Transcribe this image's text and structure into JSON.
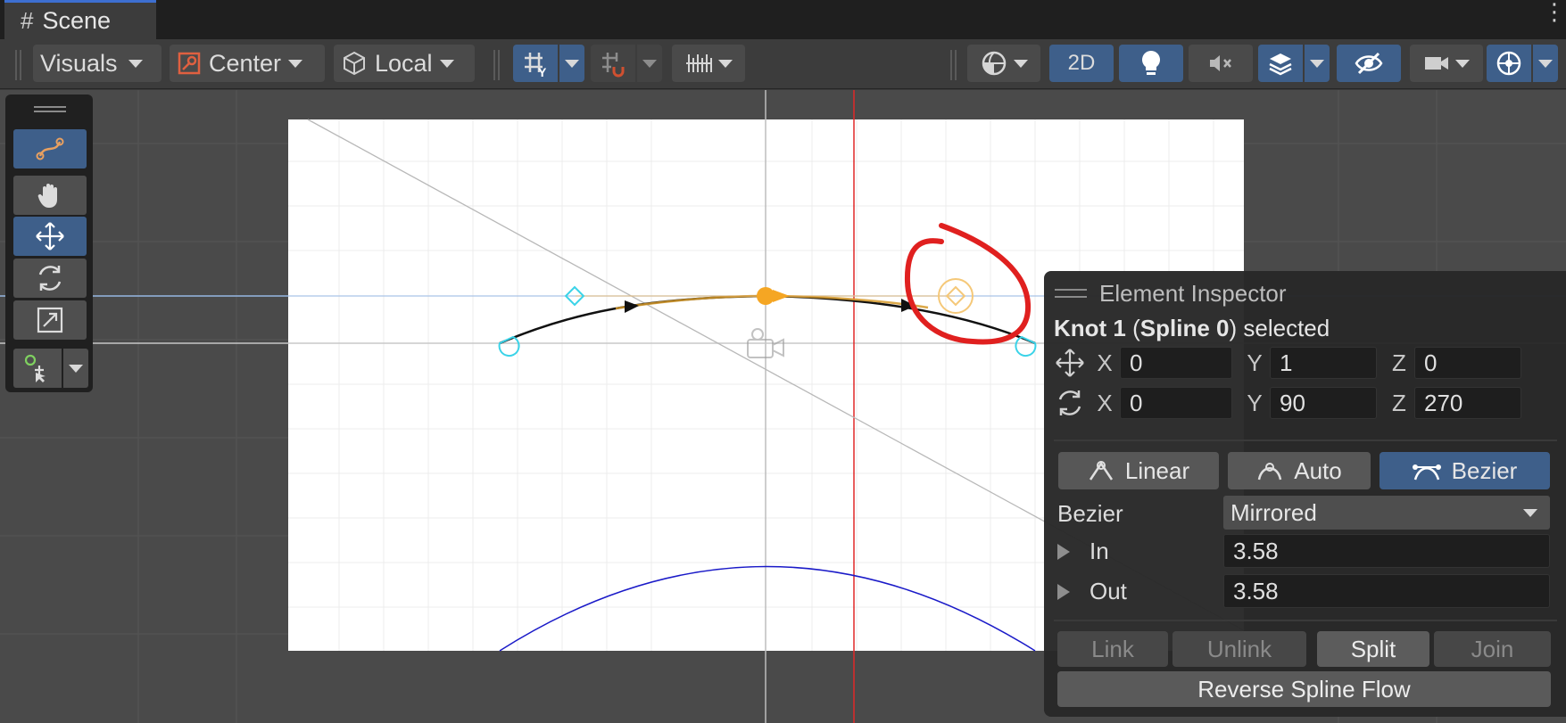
{
  "tab": {
    "title": "Scene",
    "icon": "grid-hash-icon"
  },
  "toolbar": {
    "visuals_label": "Visuals",
    "pivot_label": "Center",
    "space_label": "Local",
    "mode_2d_label": "2D",
    "active_color": "#3e5f8a"
  },
  "inspector": {
    "title": "Element Inspector",
    "selected": {
      "knot": "Knot 1",
      "spline": "Spline 0",
      "paren_open": " (",
      "paren_close": ")",
      "suffix": " selected"
    },
    "position": {
      "x_label": "X",
      "x": "0",
      "y_label": "Y",
      "y": "1",
      "z_label": "Z",
      "z": "0"
    },
    "rotation": {
      "x_label": "X",
      "x": "0",
      "y_label": "Y",
      "y": "90",
      "z_label": "Z",
      "z": "270"
    },
    "modes": {
      "linear": "Linear",
      "auto": "Auto",
      "bezier": "Bezier",
      "active": "Bezier"
    },
    "bezier_label": "Bezier",
    "bezier_mode": "Mirrored",
    "in_label": "In",
    "in_value": "3.58",
    "out_label": "Out",
    "out_value": "3.58",
    "actions": {
      "link": "Link",
      "unlink": "Unlink",
      "split": "Split",
      "join": "Join"
    },
    "reverse_label": "Reverse Spline Flow"
  },
  "colors": {
    "spline_selected": "#f5a623",
    "tangent_handle": "#3ad3e8",
    "annotation_circle": "#e0201f",
    "axis_red": "#e02828",
    "curve_blue": "#1a1ac8"
  }
}
